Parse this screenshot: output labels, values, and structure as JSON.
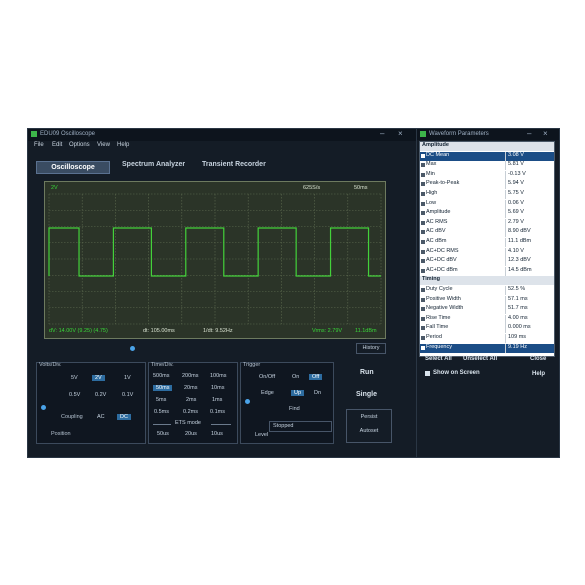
{
  "scope_window": {
    "title": "EDU09 Oscilloscope",
    "window_controls": [
      "–",
      "×"
    ],
    "menu": [
      "File",
      "Edit",
      "Options",
      "View",
      "Help"
    ],
    "tabs": [
      "Oscilloscope",
      "Spectrum Analyzer",
      "Transient Recorder"
    ],
    "screen": {
      "channel_label": "2V",
      "sample_rate": "625S/s",
      "timebase": "50ms",
      "dv_readout": "dV: 14.00V (9.25) (4.75)",
      "dt_readout": "dt: 105.00ms",
      "freq_readout": "1/dt: 9.52Hz",
      "vrms_readout": "Vrms: 2.79V",
      "dbm_readout": "11.1dBm",
      "history_button": "History"
    },
    "volts_div": {
      "title": "Volts/Div.",
      "options": [
        "5V",
        "2V",
        "1V",
        "0.5V",
        "0.2V",
        "0.1V"
      ],
      "selected": "2V",
      "coupling_label": "Coupling",
      "coupling_ac": "AC",
      "coupling_dc": "DC",
      "position_label": "Position"
    },
    "time_div": {
      "title": "Time/Div.",
      "options": [
        "500ms",
        "200ms",
        "100ms",
        "50ms",
        "20ms",
        "10ms",
        "5ms",
        "2ms",
        "1ms",
        "0.5ms",
        "0.2ms",
        "0.1ms"
      ],
      "selected": "50ms",
      "ets_label": "ETS mode",
      "ets_options": [
        "50us",
        "20us",
        "10us"
      ]
    },
    "trigger": {
      "title": "Trigger",
      "onoff_label": "On/Off",
      "on": "On",
      "off": "Off",
      "edge_label": "Edge",
      "up": "Up",
      "dn": "Dn",
      "find": "Find",
      "level_label": "Level",
      "status": "Stopped"
    },
    "run": "Run",
    "single": "Single",
    "persist": "Persist",
    "autoset": "Autoset"
  },
  "params_window": {
    "title": "Waveform Parameters",
    "window_controls": [
      "–",
      "×"
    ],
    "rows": [
      {
        "type": "header",
        "name": "Amplitude"
      },
      {
        "name": "DC Mean",
        "value": "3.08 V",
        "selected": true
      },
      {
        "name": "Max",
        "value": "5.81 V"
      },
      {
        "name": "Min",
        "value": "-0.13 V"
      },
      {
        "name": "Peak-to-Peak",
        "value": "5.94 V"
      },
      {
        "name": "High",
        "value": "5.75 V"
      },
      {
        "name": "Low",
        "value": "0.06 V"
      },
      {
        "name": "Amplitude",
        "value": "5.69 V"
      },
      {
        "name": "AC RMS",
        "value": "2.79 V"
      },
      {
        "name": "AC dBV",
        "value": "8.90 dBV"
      },
      {
        "name": "AC dBm",
        "value": "11.1 dBm"
      },
      {
        "name": "AC+DC RMS",
        "value": "4.10 V"
      },
      {
        "name": "AC+DC dBV",
        "value": "12.3 dBV"
      },
      {
        "name": "AC+DC dBm",
        "value": "14.5 dBm"
      },
      {
        "type": "header",
        "name": "Timing"
      },
      {
        "name": "Duty Cycle",
        "value": "52.5 %"
      },
      {
        "name": "Positive Width",
        "value": "57.1 ms"
      },
      {
        "name": "Negative Width",
        "value": "51.7 ms"
      },
      {
        "name": "Rise Time",
        "value": "4.00 ms"
      },
      {
        "name": "Fall Time",
        "value": "0.000 ms"
      },
      {
        "name": "Period",
        "value": "109 ms"
      },
      {
        "name": "Frequency",
        "value": "9.19 Hz",
        "selected": true
      }
    ],
    "select_all": "Select All",
    "unselect_all": "Unselect All",
    "close": "Close",
    "show_on_screen": "Show on Screen",
    "help": "Help"
  },
  "colors": {
    "trace": "#43d13a",
    "grid": "#5d6a4f",
    "readout_green": "#39d63a",
    "selection": "#2d6ca0"
  }
}
